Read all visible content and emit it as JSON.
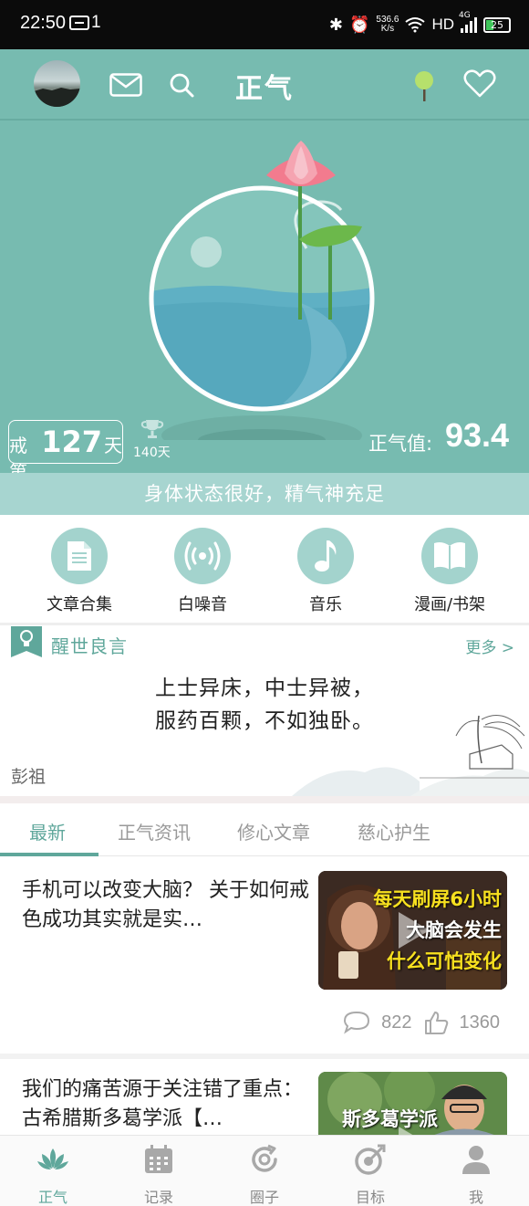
{
  "status_bar": {
    "time": "22:50",
    "notification_count": "1",
    "bluetooth": "✱",
    "alarm": "⏰",
    "network_speed_value": "536.6",
    "network_speed_unit": "K/s",
    "hd": "HD",
    "network": "4G",
    "battery": "25"
  },
  "header": {
    "title": "正气"
  },
  "hero": {
    "day_prefix": "戒第",
    "day_count": "127",
    "day_suffix": "天",
    "best_record": "140天",
    "score_label": "正气值:",
    "score_value": "93.4",
    "status_message": "身体状态很好，精气神充足"
  },
  "quick_actions": [
    {
      "label": "文章合集",
      "icon": "document-icon"
    },
    {
      "label": "白噪音",
      "icon": "broadcast-icon"
    },
    {
      "label": "音乐",
      "icon": "music-note-icon"
    },
    {
      "label": "漫画/书架",
      "icon": "book-icon"
    }
  ],
  "quote": {
    "title": "醒世良言",
    "more": "更多 >",
    "line1": "上士异床，中士异被，",
    "line2": "服药百颗，不如独卧。",
    "author": "彭祖"
  },
  "tabs": [
    "最新",
    "正气资讯",
    "修心文章",
    "慈心护生"
  ],
  "articles": [
    {
      "title": "手机可以改变大脑？ 关于如何戒色成功其实就是实…",
      "thumb_line1": "每天刷屏6小时",
      "thumb_line2": "大脑会发生",
      "thumb_line3": "什么可怕变化",
      "comments": "822",
      "likes": "1360"
    },
    {
      "title": "我们的痛苦源于关注错了重点：古希腊斯多葛学派【…",
      "thumb_caption": "斯多葛学派"
    }
  ],
  "bottom_nav": [
    {
      "label": "正气",
      "icon": "lotus-icon"
    },
    {
      "label": "记录",
      "icon": "calendar-icon"
    },
    {
      "label": "圈子",
      "icon": "circle-refresh-icon"
    },
    {
      "label": "目标",
      "icon": "target-icon"
    },
    {
      "label": "我",
      "icon": "person-icon"
    }
  ],
  "colors": {
    "accent": "#77bbb0",
    "accent_dark": "#5fa79b",
    "status_strip": "#a7d5d0",
    "icon_circle": "#a3d3cd"
  }
}
